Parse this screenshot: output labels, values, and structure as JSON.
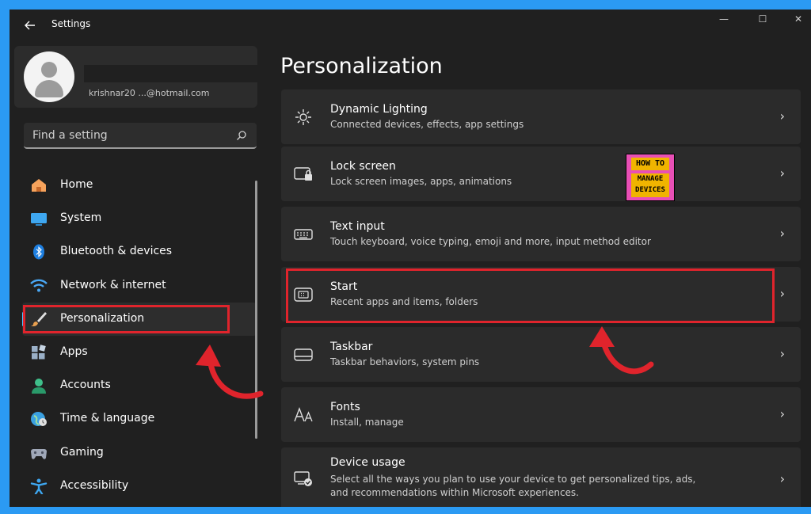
{
  "titlebar": {
    "title": "Settings",
    "minimize": "—",
    "maximize": "☐",
    "close": "✕"
  },
  "profile": {
    "email": "krishnar20 ...@hotmail.com"
  },
  "search": {
    "placeholder": "Find a setting",
    "icon": "search-icon"
  },
  "nav": {
    "items": [
      {
        "label": "Home",
        "icon": "home-icon",
        "color": "#f7a35c"
      },
      {
        "label": "System",
        "icon": "system-icon",
        "color": "#3ea7f0"
      },
      {
        "label": "Bluetooth & devices",
        "icon": "bluetooth-icon",
        "color": "#1e7fe0"
      },
      {
        "label": "Network & internet",
        "icon": "wifi-icon",
        "color": "#4aa8f5"
      },
      {
        "label": "Personalization",
        "icon": "brush-icon",
        "color": "#e8a050"
      },
      {
        "label": "Apps",
        "icon": "apps-icon",
        "color": "#9ab0c8"
      },
      {
        "label": "Accounts",
        "icon": "accounts-icon",
        "color": "#3fbf8a"
      },
      {
        "label": "Time & language",
        "icon": "globe-icon",
        "color": "#3aa0e0"
      },
      {
        "label": "Gaming",
        "icon": "gaming-icon",
        "color": "#a0a8b8"
      },
      {
        "label": "Accessibility",
        "icon": "accessibility-icon",
        "color": "#3ea7f0"
      }
    ],
    "selected_index": 4
  },
  "main": {
    "title": "Personalization",
    "cards": [
      {
        "title": "Dynamic Lighting",
        "subtitle": "Connected devices, effects, app settings",
        "icon": "dynamic-lighting-icon"
      },
      {
        "title": "Lock screen",
        "subtitle": "Lock screen images, apps, animations",
        "icon": "lock-screen-icon"
      },
      {
        "title": "Text input",
        "subtitle": "Touch keyboard, voice typing, emoji and more, input method editor",
        "icon": "keyboard-icon"
      },
      {
        "title": "Start",
        "subtitle": "Recent apps and items, folders",
        "icon": "start-icon"
      },
      {
        "title": "Taskbar",
        "subtitle": "Taskbar behaviors, system pins",
        "icon": "taskbar-icon"
      },
      {
        "title": "Fonts",
        "subtitle": "Install, manage",
        "icon": "fonts-icon"
      },
      {
        "title": "Device usage",
        "subtitle": "Select all the ways you plan to use your device to get personalized tips, ads, and recommendations within Microsoft experiences.",
        "icon": "device-usage-icon"
      }
    ],
    "chevron": "›"
  },
  "watermark": {
    "line1": "HOW TO",
    "line2": "MANAGE",
    "line3": "DEVICES"
  },
  "colors": {
    "accent": "#4cc2ff",
    "highlight": "#e0242c",
    "frame": "#2b9af3"
  }
}
